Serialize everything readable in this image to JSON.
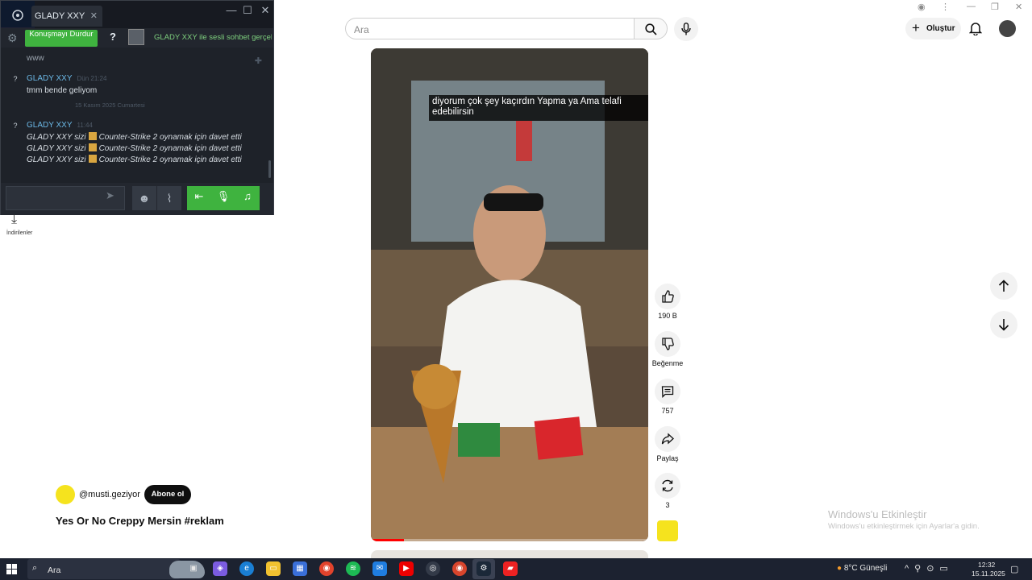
{
  "steam_chat": {
    "tab_title": "GLADY XXY",
    "stop_button": "Konuşmayı Durdur",
    "help": "?",
    "voice_status": "GLADY XXY ile sesli sohbet gerçekleşt...",
    "partial_message_top": "www",
    "messages": [
      {
        "sender": "GLADY XXY",
        "time": "Dün 21:24",
        "text": "tmm bende geliyom"
      },
      {
        "sender": "GLADY XXY",
        "time": "11:44",
        "text": ""
      }
    ],
    "date_divider": "15 Kasım 2025 Cumartesi",
    "invites": [
      {
        "prefix": "GLADY XXY sizi",
        "rest": "Counter-Strike 2 oynamak için davet etti"
      },
      {
        "prefix": "GLADY XXY sizi",
        "rest": "Counter-Strike 2 oynamak için davet etti"
      },
      {
        "prefix": "GLADY XXY sizi",
        "rest": "Counter-Strike 2 oynamak için davet etti"
      }
    ]
  },
  "desktop": {
    "downloads_label": "İndirilenler"
  },
  "youtube": {
    "search_placeholder": "Ara",
    "create_label": "Oluştur",
    "caption": "diyorum çok şey kaçırdın Yapma ya Ama telafi edebilirsin",
    "progress": 0.12,
    "like_count": "190 B",
    "dislike_label": "Beğenme",
    "comment_count": "757",
    "share_label": "Paylaş",
    "remix_count": "3",
    "channel_handle": "@musti.geziyor",
    "subscribe_label": "Abone ol",
    "video_title": "Yes Or No Creppy Mersin #reklam"
  },
  "watermark": {
    "line1": "Windows'u Etkinleştir",
    "line2": "Windows'u etkinleştirmek için Ayarlar'a gidin."
  },
  "taskbar": {
    "search_text": "Ara",
    "weather": "8°C  Güneşli",
    "time": "12:32",
    "date": "15.11.2025"
  },
  "colors": {
    "steam_green": "#3fb33f",
    "steam_name_blue": "#6bb8e6",
    "yt_red": "#ff0000",
    "taskbar_bg": "#1c2230"
  }
}
